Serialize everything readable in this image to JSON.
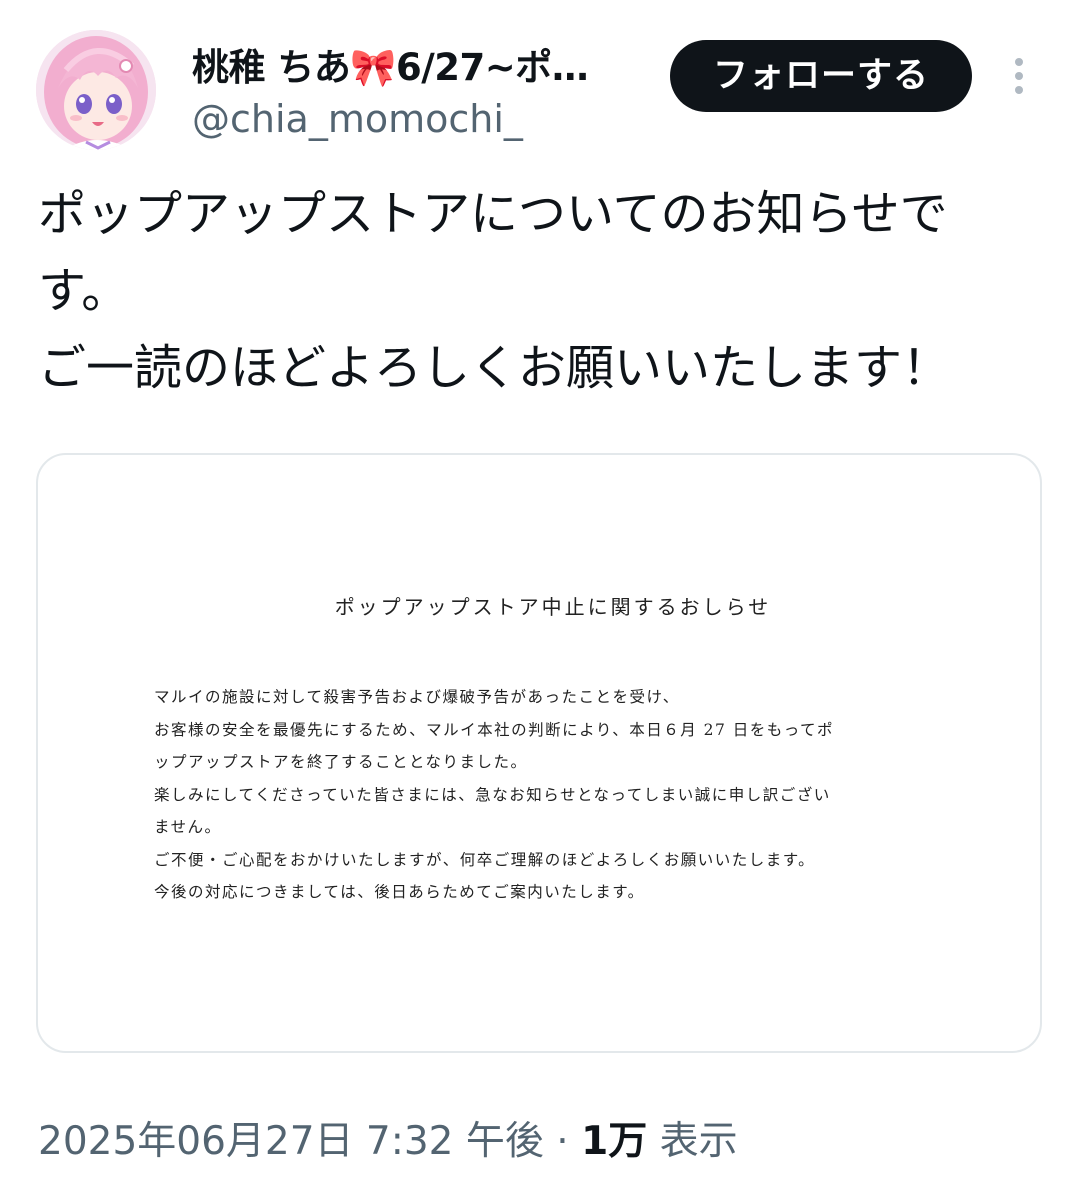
{
  "author": {
    "display_name": "桃稚 ちあ",
    "display_name_emoji": "🎀",
    "display_name_suffix": "6/27~ポ…",
    "handle": "@chia_momochi_",
    "avatar_icon": "anime-girl-avatar"
  },
  "actions": {
    "follow_label": "フォローする",
    "more_icon": "more-vertical-icon"
  },
  "tweet": {
    "text": "ポップアップストアについてのお知らせです。\nご一読のほどよろしくお願いいたします！"
  },
  "notice": {
    "title": "ポップアップストア中止に関するおしらせ",
    "lines": [
      "マルイの施設に対して殺害予告および爆破予告があったことを受け、",
      "お客様の安全を最優先にするため、マルイ本社の判断により、本日６月 27 日をもってポ",
      "ップアップストアを終了することとなりました。",
      "楽しみにしてくださっていた皆さまには、急なお知らせとなってしまい誠に申し訳ござい",
      "ません。",
      "ご不便・ご心配をおかけいたしますが、何卒ご理解のほどよろしくお願いいたします。",
      "今後の対応につきましては、後日あらためてご案内いたします。"
    ]
  },
  "meta": {
    "timestamp": "2025年06月27日 7:32 午後",
    "separator": "·",
    "views_count": "1万",
    "views_label": "表示"
  },
  "colors": {
    "follow_bg": "#0f1419",
    "secondary_text": "#536471",
    "card_border": "#e3e8eb"
  }
}
